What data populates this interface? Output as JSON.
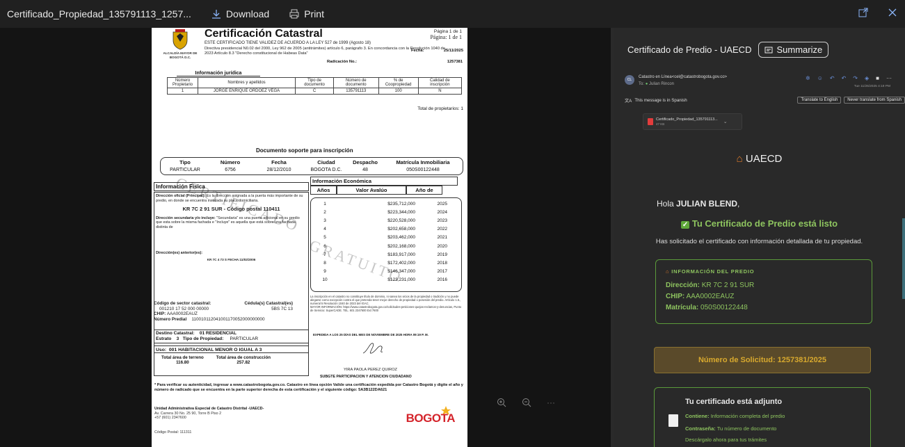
{
  "toolbar": {
    "file_name": "Certificado_Propiedad_135791113_1257...",
    "download_label": "Download",
    "print_label": "Print",
    "icons": [
      "download-icon",
      "print-icon",
      "popout-icon",
      "close-icon"
    ]
  },
  "document": {
    "alcaldia": "ALCALDÍA MAYOR DE BOGOTÁ D.C.",
    "title": "Certificación Catastral",
    "line1": "ESTE CERTIFICADO TIENE VALIDEZ DE ACUERDO A LA LEY 527  de 1999 (Agosto 18)",
    "line2": "Directiva presidencial N0.02 del 2000, Ley 962 de 2005 (antitrámites) artículo 6, parágrafo 3. En concordancia con la Resolución 1040 de 2023 Artículo 8.3 \"Derecho constitucional de Habeas Data\"",
    "page1": "Página 1 de 1",
    "page2": "Página: 1 de 1",
    "fecha_label": "Fecha:",
    "fecha": "25/11/2025",
    "rad_label": "Radicación No.:",
    "rad": "1257381",
    "info_juridica": "Información jurídica",
    "owners_headers": [
      "Número Propietario",
      "Nombres y apellidos",
      "Tipo de documento",
      "Número de documento",
      "% de Coopropiedad",
      "Calidad de inscripción"
    ],
    "owners": [
      [
        "1",
        "JORGE ENRIQUE ORDOEZ VEGA",
        "C",
        "135791113",
        "100",
        "N"
      ]
    ],
    "total_prop": "Total de propietarios: 1",
    "doc_soporte": "Documento soporte para inscripción",
    "soporte_headers": [
      "Tipo",
      "Número",
      "Fecha",
      "Ciudad",
      "Despacho",
      "Matrícula Inmobiliaria"
    ],
    "soporte_values": [
      "PARTICULAR",
      "6756",
      "28/12/2010",
      "BOGOTA D.C.",
      "48",
      "050S00122448"
    ],
    "info_fisica": "Información Física",
    "dir_oficial": "Dirección oficial (Principal):",
    "dir_oficial_desc": "Es la dirección asignada a la puerta más importante de su predio, en donde se encuentra instalada su placa domiciliaria.",
    "dir_kr": "KR 7C 2 91 SUR -  Código postal 110411",
    "dir_secundaria": "Dirección secundaria y/o incluye:",
    "dir_secundaria_desc": "\"Secundaria\" es una puerta adicional en su predio que esta sobre la misma fachada e \"Incluye\" es aquella que está sobre una fachada distinta de",
    "dir_anterior": "Dirección(es) anterior(es):",
    "dir_anterior_val": "KR 7C 4 73 S   FECHA:11/02/2006",
    "info_economica": "Información Económica",
    "econ_headers": [
      "Años",
      "Valor Avalúo",
      "Año de"
    ],
    "avaluos": [
      [
        "1",
        "$235,712,000",
        "2025"
      ],
      [
        "2",
        "$223,344,000",
        "2024"
      ],
      [
        "3",
        "$220,528,000",
        "2023"
      ],
      [
        "4",
        "$202,658,000",
        "2022"
      ],
      [
        "5",
        "$203,462,000",
        "2021"
      ],
      [
        "6",
        "$202,168,000",
        "2020"
      ],
      [
        "7",
        "$183,917,000",
        "2019"
      ],
      [
        "8",
        "$172,402,000",
        "2018"
      ],
      [
        "9",
        "$146,347,000",
        "2017"
      ],
      [
        "10",
        "$123,231,000",
        "2016"
      ]
    ],
    "nota": "La inscripción en el catastro no constituye título de dominio, ni sanea los vicios de la propiedad o tradición y no puede alegarse como excepción contra el que pretenda tener mejor derecho de propiedad o posesión del predio. Artículo 1.5., numeral 5 Resolución 1040 de 2023 del IGAC.",
    "nota2": "MAYOR INFORMACIÓN: https://www.catastrobogota.gov.co/solicitudes-peticiones-quejas-reclamos-y-denuncias, Punto de Servicio: SuperCADE. TEL. 601 2347600 Ext 7600",
    "expedida": "EXPEDIDA A LOS  25  DÍAS DEL MES DE  NOVIEMBRE  DE  2025  HORA  09:19 P. M.",
    "firmante": "YIRA PAOLA PEREZ QUIROZ",
    "subgte": "SUBGTE PARTICIPACION Y ATENCION CIUDADANO",
    "cod_sector_label": "Código de sector catastral:",
    "cod_sector": "001210 17 52 000 00000",
    "cedula_label": "Cédula(s) Catastral(es)",
    "cedula": "5BS 7C 13",
    "chip_label": "CHIP:",
    "chip": "AAA0002EAUZ",
    "predial_label": "Número Predial",
    "predial": "110010112041001170052000000000",
    "destino_label": "Destino Catastral:",
    "destino": "01 RESIDENCIAL",
    "estrato_label": "Estrato",
    "estrato": "3",
    "tipo_prop_label": "Tipo de Propiedad:",
    "tipo_prop": "PARTICULAR",
    "uso_label": "Uso:",
    "uso": "001 HABITACIONAL MENOR O IGUAL A 3",
    "area_terreno_label": "Total área de terreno",
    "area_terreno": "116.80",
    "area_const_label": "Total área de construcción",
    "area_const": "257.82",
    "verif": "* Para verificar su autenticidad, ingresar a www.catastrobogota.gov.co. Catastro en línea opción Valide una certificación expedida por Catastro Bogotá y digite el año y número de radicado que se encuentra en la parte superior derecha de esta certificación y el siguiente código: 5A3B122DA621",
    "unidad": "Unidad Administrativa Especial de Catastro Distrital -UAECD-",
    "direccion_uaecd": "Av. Carrera 30 No. 25 90, Torre B Piso 2",
    "telefono": "+57 (601) 2347600",
    "postal": "Código Postal: 111311",
    "bogota_logo": "BOGOTA",
    "watermark1": "CERTIFICADO",
    "watermark2": "GRATUITO"
  },
  "email": {
    "subject": "Certificado de Predio - UAECD",
    "summarize": "Summarize",
    "avatar_initials": "CL",
    "from": "Catastro en Línea<cel@catastrobogota.gov.co>",
    "to_label": "To:",
    "to": "Julian Rincon",
    "date": "Tue 11/25/2025 4:19 PM",
    "lang_msg": "This message is in Spanish",
    "translate_btn": "Translate to English",
    "never_btn": "Never translate from Spanish",
    "attachment_name": "Certificado_Propiedad_135791113...",
    "attachment_size": "47 KB",
    "brand": "UAECD",
    "greeting_prefix": "Hola ",
    "greeting_name": "JULIAN BLEND",
    "greeting_suffix": ",",
    "listo": "Tu Certificado de Predio está listo",
    "solicitado": "Has solicitado el certificado con información detallada de tu propiedad.",
    "info_header": "INFORMACIÓN DEL PREDIO",
    "dir_label": "Dirección:",
    "dir_value": "KR 7C 2 91 SUR",
    "chip_label": "CHIP:",
    "chip_value": "AAA0002EAUZ",
    "matricula_label": "Matrícula:",
    "matricula_value": "050S00122448",
    "solicitud": "Número de Solicitud: 1257381/2025",
    "adjunto_title": "Tu certificado está adjunto",
    "contiene_label": "Contiene:",
    "contiene": "Información completa del predio",
    "contrasena_label": "Contraseña:",
    "contrasena": "Tu número de documento",
    "descargalo": "Descárgalo ahora para tus trámites"
  },
  "colors": {
    "accent_green": "#8ec45f",
    "accent_gold": "#d8a92e",
    "link_blue": "#6a8fd8"
  }
}
